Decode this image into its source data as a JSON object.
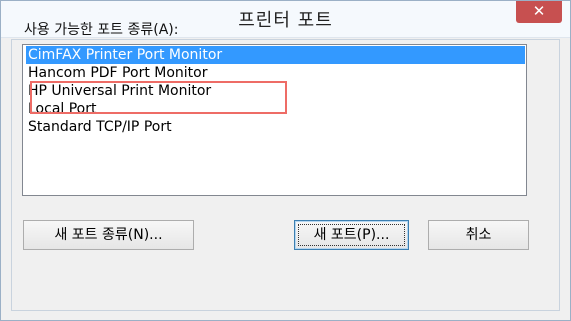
{
  "window": {
    "title": "프린터 포트",
    "close_glyph": "✕"
  },
  "ports": {
    "label": "사용 가능한 포트 종류(A):",
    "items": [
      "CimFAX Printer Port Monitor",
      "Hancom PDF Port Monitor",
      "HP Universal Print Monitor",
      "Local Port",
      "Standard TCP/IP Port"
    ],
    "selected_index": 0
  },
  "buttons": {
    "new_port_type": "새 포트 종류(N)...",
    "new_port": "새 포트(P)...",
    "cancel": "취소"
  },
  "colors": {
    "selection": "#3399ff",
    "annotation_box": "#ee6c66",
    "close_button": "#c75050"
  }
}
